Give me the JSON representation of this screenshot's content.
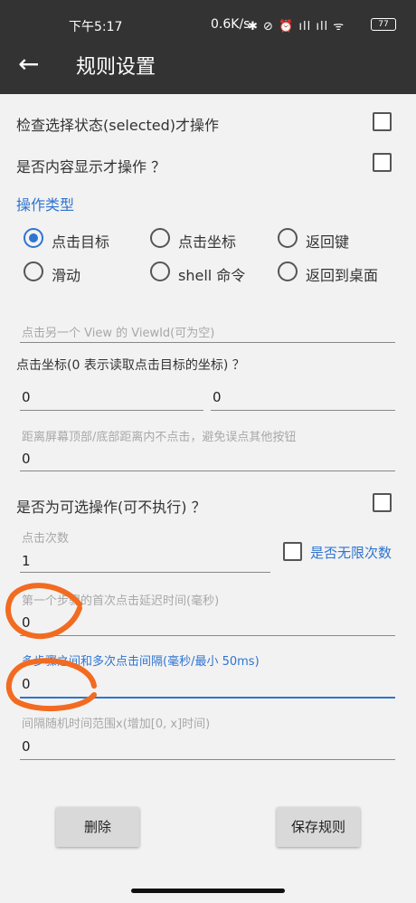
{
  "status_bar": {
    "time": "下午5:17",
    "net_speed": "0.6K/s",
    "icons": "✱ ⊘ ⏰ ıll ıll ᯤ",
    "battery": "77"
  },
  "app_bar": {
    "back_icon": "←",
    "title": "规则设置"
  },
  "options": {
    "check_selected_label": "检查选择状态(selected)才操作",
    "content_visible_label": "是否内容显示才操作 ？"
  },
  "op_type": {
    "section_label": "操作类型",
    "radios": [
      {
        "label": "点击目标",
        "checked": true
      },
      {
        "label": "点击坐标",
        "checked": false
      },
      {
        "label": "返回键",
        "checked": false
      },
      {
        "label": "滑动",
        "checked": false
      },
      {
        "label": "shell 命令",
        "checked": false
      },
      {
        "label": "返回到桌面",
        "checked": false
      }
    ]
  },
  "view_id": {
    "hint": "点击另一个 View 的 ViewId(可为空)"
  },
  "coord": {
    "label": "点击坐标(0 表示读取点击目标的坐标) ？",
    "x_value": "0",
    "y_value": "0"
  },
  "edge": {
    "hint": "距离屏幕顶部/底部距离内不点击，避免误点其他按钮",
    "value": "0"
  },
  "optional": {
    "label": "是否为可选操作(可不执行) ？"
  },
  "click_count": {
    "hint": "点击次数",
    "value": "1",
    "infinite_label": "是否无限次数"
  },
  "first_delay": {
    "hint": "第一个步骤的首次点击延迟时间(毫秒)",
    "value": "0"
  },
  "interval": {
    "hint": "多步骤之间和多次点击间隔(毫秒/最小 50ms)",
    "value": "0"
  },
  "random_range": {
    "hint": "间隔随机时间范围x(增加[0, x]时间)",
    "value": "0"
  },
  "buttons": {
    "delete": "删除",
    "save": "保存规则"
  },
  "colors": {
    "accent": "#2f74d0",
    "annotation": "#f26b21",
    "appbar": "#333333"
  }
}
